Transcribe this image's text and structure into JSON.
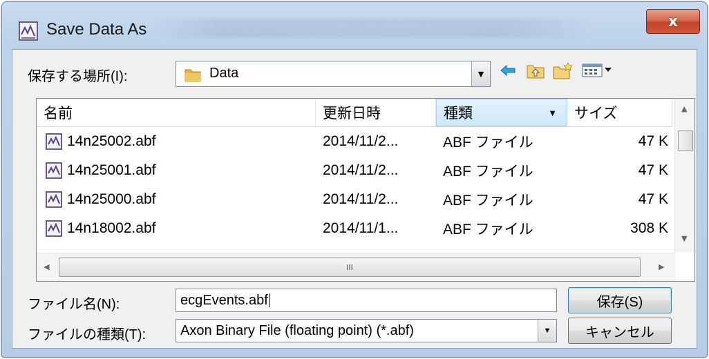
{
  "window": {
    "title": "Save Data As",
    "close_label": "x"
  },
  "location": {
    "label": "保存する場所(I):",
    "value": "Data"
  },
  "columns": {
    "name": "名前",
    "modified": "更新日時",
    "type": "種類",
    "size": "サイズ"
  },
  "files": [
    {
      "name": "14n25002.abf",
      "modified": "2014/11/2...",
      "type": "ABF ファイル",
      "size": "47 K"
    },
    {
      "name": "14n25001.abf",
      "modified": "2014/11/2...",
      "type": "ABF ファイル",
      "size": "47 K"
    },
    {
      "name": "14n25000.abf",
      "modified": "2014/11/2...",
      "type": "ABF ファイル",
      "size": "47 K"
    },
    {
      "name": "14n18002.abf",
      "modified": "2014/11/1...",
      "type": "ABF ファイル",
      "size": "308 K"
    }
  ],
  "scrollbar": {
    "grip": "III"
  },
  "filename": {
    "label": "ファイル名(N):",
    "value": "ecgEvents.abf"
  },
  "filetype": {
    "label": "ファイルの種類(T):",
    "value": "Axon Binary File (floating point) (*.abf)"
  },
  "buttons": {
    "save": "保存(S)",
    "cancel": "キャンセル"
  },
  "icons": {
    "title": "abf-file-icon",
    "folder": "folder-icon",
    "back": "back-arrow-icon",
    "up": "up-folder-icon",
    "new_folder": "new-folder-icon",
    "view": "view-menu-icon"
  },
  "colors": {
    "titlebar": "#bcd3ea",
    "close_button": "#c2442a",
    "sort_header": "#cfe8fa",
    "dialog_bg": "#f0f0f0"
  }
}
